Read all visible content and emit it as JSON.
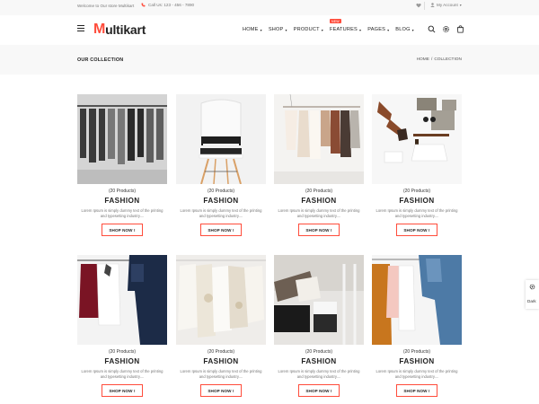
{
  "topbar": {
    "welcome": "Welcome to Our store Multikart",
    "call": "Call Us: 123 - 456 - 7890",
    "account": "My Account"
  },
  "header": {
    "logo_initial": "M",
    "logo_rest": "ultikart",
    "nav": [
      {
        "label": "HOME"
      },
      {
        "label": "SHOP"
      },
      {
        "label": "PRODUCT"
      },
      {
        "label": "FEATURES",
        "badge": "NEW"
      },
      {
        "label": "PAGES"
      },
      {
        "label": "BLOG"
      }
    ]
  },
  "breadcrumb": {
    "page_title": "OUR COLLECTION",
    "home": "HOME",
    "separator": "/",
    "current": "COLLECTION"
  },
  "collections": [
    {
      "count": "(20 Products)",
      "name": "FASHION",
      "desc_line1": "Lorem Ipsum is simply dummy text of the printing",
      "desc_line2": "and typesetting industry....",
      "button": "SHOP NOW !"
    },
    {
      "count": "(20 Products)",
      "name": "FASHION",
      "desc_line1": "Lorem Ipsum is simply dummy text of the printing",
      "desc_line2": "and typesetting industry....",
      "button": "SHOP NOW !"
    },
    {
      "count": "(20 Products)",
      "name": "FASHION",
      "desc_line1": "Lorem Ipsum is simply dummy text of the printing",
      "desc_line2": "and typesetting industry....",
      "button": "SHOP NOW !"
    },
    {
      "count": "(20 Products)",
      "name": "FASHION",
      "desc_line1": "Lorem Ipsum is simply dummy text of the printing",
      "desc_line2": "and typesetting industry....",
      "button": "SHOP NOW !"
    },
    {
      "count": "(20 Products)",
      "name": "FASHION",
      "desc_line1": "Lorem Ipsum is simply dummy text of the printing",
      "desc_line2": "and typesetting industry....",
      "button": "SHOP NOW !"
    },
    {
      "count": "(20 Products)",
      "name": "FASHION",
      "desc_line1": "Lorem Ipsum is simply dummy text of the printing",
      "desc_line2": "and typesetting industry....",
      "button": "SHOP NOW !"
    },
    {
      "count": "(20 Products)",
      "name": "FASHION",
      "desc_line1": "Lorem Ipsum is simply dummy text of the printing",
      "desc_line2": "and typesetting industry....",
      "button": "SHOP NOW !"
    },
    {
      "count": "(20 Products)",
      "name": "FASHION",
      "desc_line1": "Lorem Ipsum is simply dummy text of the printing",
      "desc_line2": "and typesetting industry....",
      "button": "SHOP NOW !"
    }
  ],
  "side_panel": {
    "label": "Dark"
  },
  "colors": {
    "accent": "#ff4c3b",
    "band": "#f8f8f8",
    "text": "#222222"
  }
}
